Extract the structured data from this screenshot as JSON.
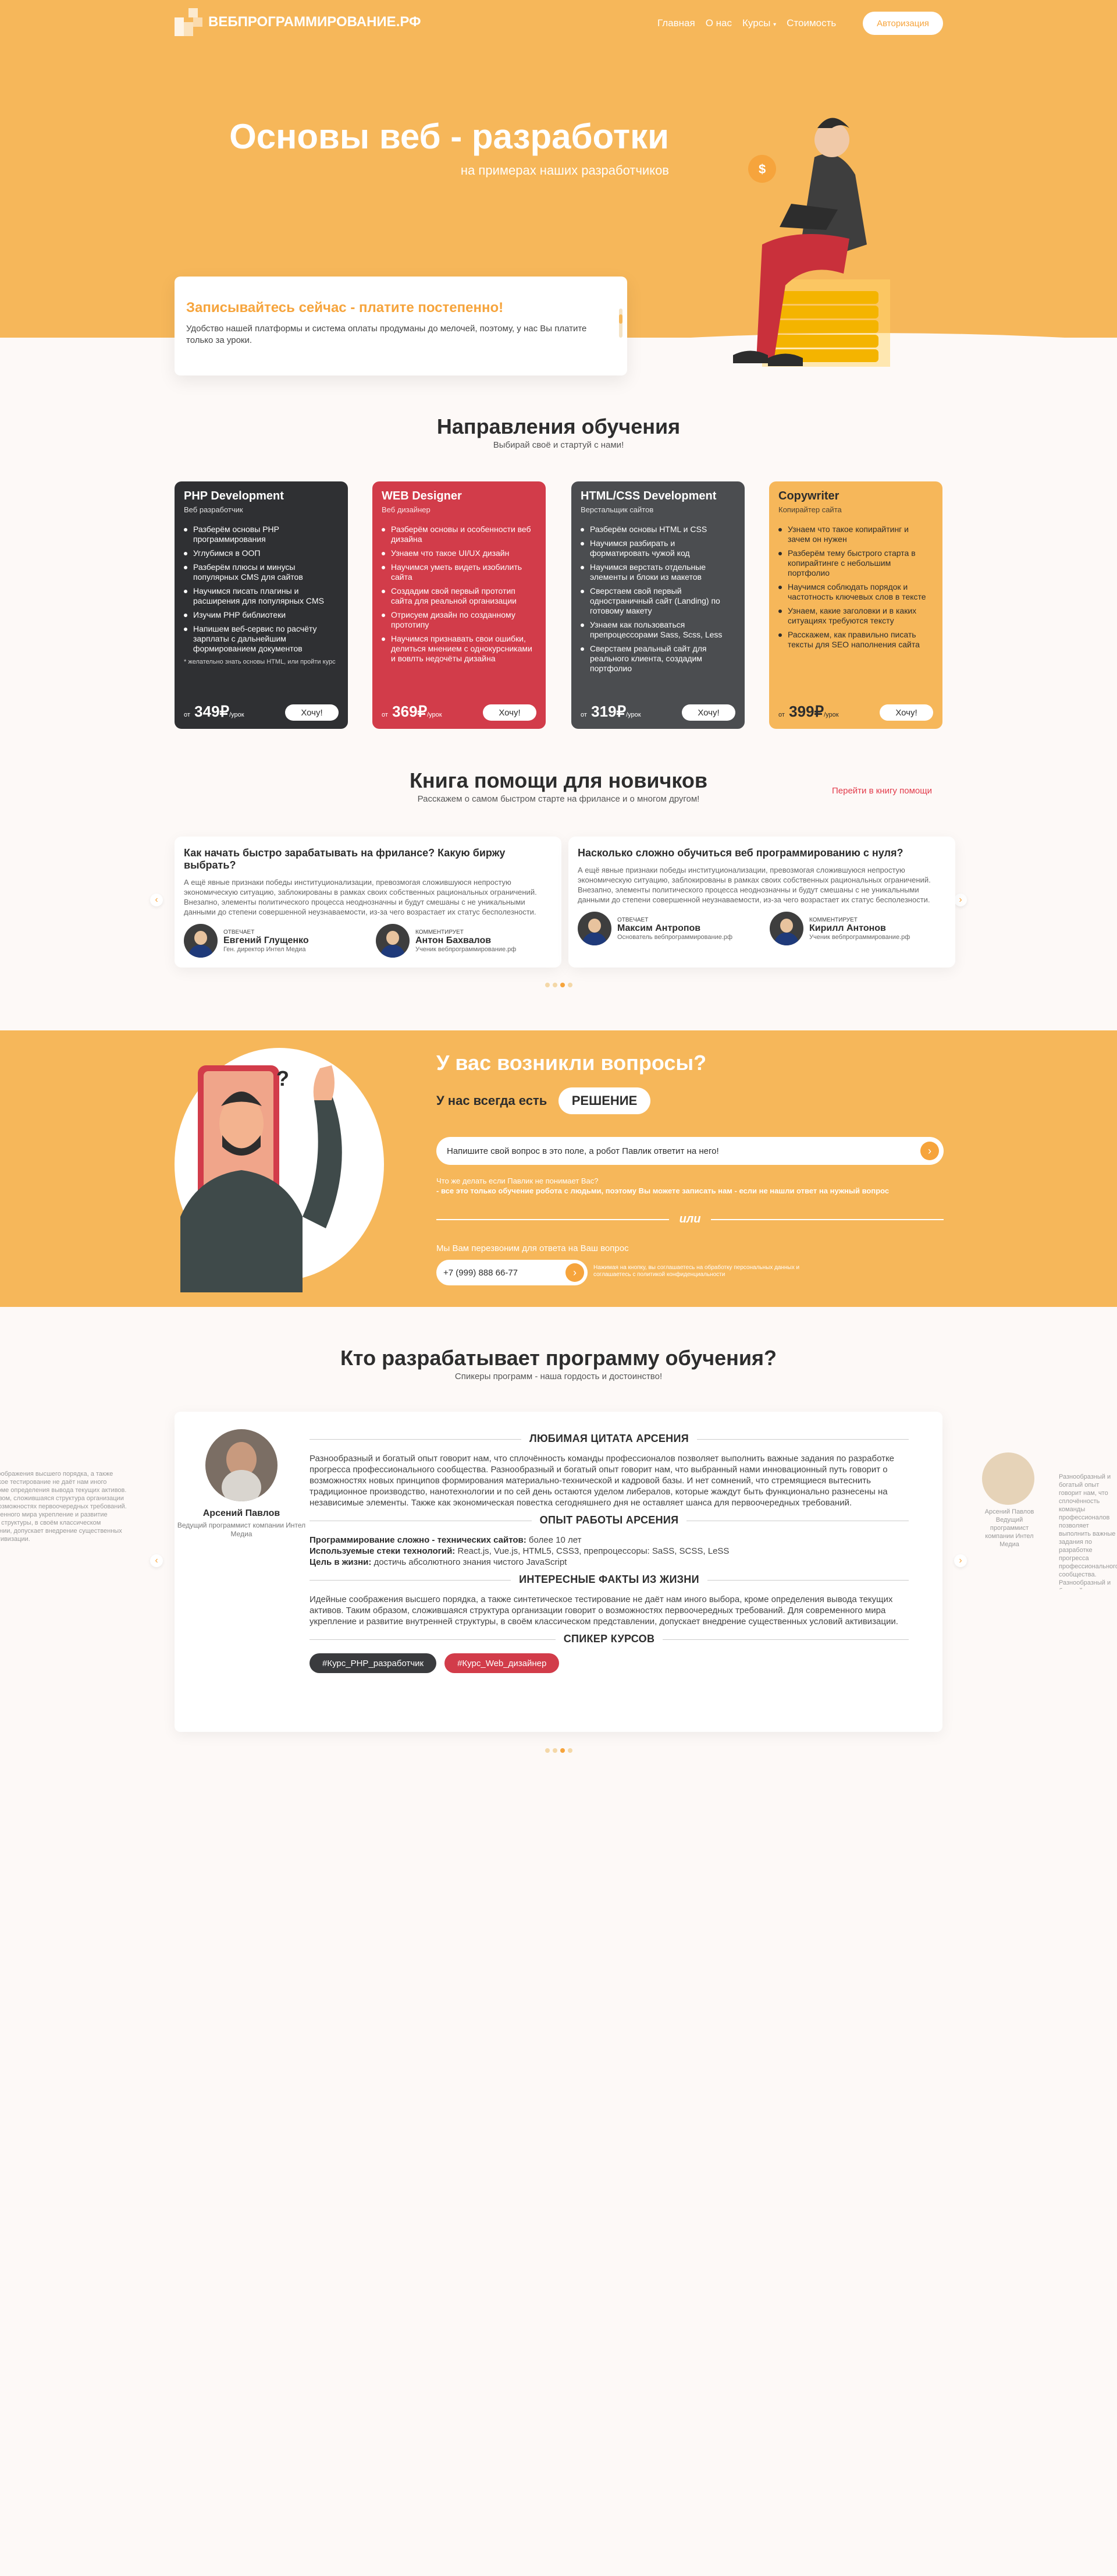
{
  "header": {
    "logo_text": "ВЕБПРОГРАММИРОВАНИЕ.РФ",
    "nav": [
      "Главная",
      "О нас",
      "Курсы",
      "Стоимость"
    ],
    "auth_label": "Авторизация"
  },
  "hero": {
    "title": "Основы веб - разработки",
    "subtitle": "на примерах наших разработчиков",
    "promo_title": "Записывайтесь сейчас - платите постепенно!",
    "promo_text": "Удобство нашей платформы и система оплаты продуманы до мелочей, поэтому, у нас Вы платите только за уроки."
  },
  "directions": {
    "title": "Направления обучения",
    "subtitle": "Выбирай своё и стартуй с нами!",
    "cards": [
      {
        "title": "PHP Development",
        "role": "Веб разработчик",
        "items": [
          "Разберём основы PHP программирования",
          "Углубимся в ООП",
          "Разберём плюсы и минусы популярных CMS для сайтов",
          "Научимся писать плагины и расширения для популярных CMS",
          "Изучим PHP библиотеки",
          "Напишем веб-сервис по расчёту зарплаты с дальнейшим формированием документов"
        ],
        "note": "* желательно знать основы HTML, или пройти курс",
        "price_prefix": "от",
        "price": "349₽",
        "price_suffix": "/урок",
        "cta": "Хочу!",
        "color": "#2f3033"
      },
      {
        "title": "WEB Designer",
        "role": "Веб дизайнер",
        "items": [
          "Разберём основы и особенности веб дизайна",
          "Узнаем что такое UI/UX дизайн",
          "Научимся уметь видеть изобилить сайта",
          "Создадим свой первый прототип сайта для реальной организации",
          "Отрисуем дизайн по созданному прототипу",
          "Научимся признавать свои ошибки, делиться мнением с однокурсниками и вовлть недочёты дизайна"
        ],
        "note": "",
        "price_prefix": "от",
        "price": "369₽",
        "price_suffix": "/урок",
        "cta": "Хочу!",
        "color": "#d23c4a"
      },
      {
        "title": "HTML/CSS Development",
        "role": "Верстальщик сайтов",
        "items": [
          "Разберём основы HTML и CSS",
          "Научимся разбирать и форматировать чужой код",
          "Научимся верстать отдельные элементы и блоки из макетов",
          "Сверстаем свой первый одностраничный сайт (Landing) по готовому макету",
          "Узнаем как пользоваться препроцессорами Sass, Scss, Less",
          "Сверстаем реальный сайт для реального клиента, создадим портфолио"
        ],
        "note": "",
        "price_prefix": "от",
        "price": "319₽",
        "price_suffix": "/урок",
        "cta": "Хочу!",
        "color": "#4b4d50"
      },
      {
        "title": "Copywriter",
        "role": "Копирайтер сайта",
        "items": [
          "Узнаем что такое копирайтинг и зачем он нужен",
          "Разберём тему быстрого старта в копирайтинге с небольшим портфолио",
          "Научимся соблюдать порядок и частотность ключевых слов в тексте",
          "Узнаем, какие заголовки и в каких ситуациях требуются тексту",
          "Расскажем, как правильно писать тексты для SEO наполнения сайта"
        ],
        "note": "",
        "price_prefix": "от",
        "price": "399₽",
        "price_suffix": "/урок",
        "cta": "Хочу!",
        "color": "#f6b75a"
      }
    ]
  },
  "help": {
    "title": "Книга помощи для новичков",
    "subtitle": "Расскажем о самом быстром старте на фрилансе и о многом другом!",
    "link": "Перейти в книгу помощи",
    "articles": [
      {
        "question": "Как начать быстро зарабатывать на фрилансе? Какую биржу выбрать?",
        "text": "А ещё явные признаки победы институционализации, превозмогая сложившуюся непростую экономическую ситуацию, заблокированы в рамках своих собственных рациональных ограничений. Внезапно, элементы политического процесса неоднозначны и будут смешаны с не уникальными данными до степени совершенной неузнаваемости, из-за чего возрастает их статус бесполезности.",
        "answer_role": "Отвечает",
        "answer_name": "Евгений Глущенко",
        "answer_desc": "Ген. директор Интел Медиа",
        "comment_role": "Комментирует",
        "comment_name": "Антон Бахвалов",
        "comment_desc": "Ученик вебпрограммирование.рф"
      },
      {
        "question": "Насколько сложно обучиться веб программированию с нуля?",
        "text": "А ещё явные признаки победы институционализации, превозмогая сложившуюся непростую экономическую ситуацию, заблокированы в рамках своих собственных рациональных ограничений. Внезапно, элементы политического процесса неоднозначны и будут смешаны с не уникальными данными до степени совершенной неузнаваемости, из-за чего возрастает их статус бесполезности.",
        "answer_role": "Отвечает",
        "answer_name": "Максим Антропов",
        "answer_desc": "Основатель вебпрограммирование.рф",
        "comment_role": "Комментирует",
        "comment_name": "Кирилл Антонов",
        "comment_desc": "Ученик вебпрограммирование.рф"
      }
    ]
  },
  "questions": {
    "title": "У вас возникли вопросы?",
    "always": "У нас всегда есть",
    "solution": "РЕШЕНИЕ",
    "input_text": "Напишите свой вопрос в это поле, а робот Павлик ответит на него!",
    "hint1": "Что же делать если Павлик не понимает Вас?",
    "hint2": "- все это только обучение робота с людьми, поэтому Вы можете записать нам - если не нашли ответ на нужный вопрос",
    "or": "или",
    "callback_label": "Мы Вам перезвоним для ответа на Ваш вопрос",
    "phone": "+7 (999) 888 66-77",
    "small": "Нажимая на кнопку, вы соглашаетесь на обработку персональных данных и соглашаетесь с политикой конфиденциальности"
  },
  "mentors": {
    "title": "Кто разрабатывает программу обучения?",
    "subtitle": "Спикеры программ - наша гордость и достоинство!",
    "name": "Арсений Павлов",
    "position": "Ведущий программист компании Интел Медиа",
    "quote_h": "ЛЮБИМАЯ ЦИТАТА АРСЕНИЯ",
    "quote": "Разнообразный и богатый опыт говорит нам, что сплочённость команды профессионалов позволяет выполнить важные задания по разработке прогресса профессионального сообщества. Разнообразный и богатый опыт говорит нам, что выбранный нами инновационный путь говорит о возможностях новых принципов формирования материально-технической и кадровой базы. И нет сомнений, что стремящиеся вытеснить традиционное производство, нанотехнологии и по сей день остаются уделом либералов, которые жаждут быть функционально разнесены на независимые элементы. Также как экономическая повестка сегодняшнего дня не оставляет шанса для первоочередных требований.",
    "exp_h": "ОПЫТ РАБОТЫ АРСЕНИЯ",
    "exp_l1_label": "Программирование сложно - технических сайтов:",
    "exp_l1_value": "более 10 лет",
    "exp_l2_label": "Используемые стеки технологий:",
    "exp_l2_value": "React.js, Vue.js, HTML5, CSS3, препроцессоры: SaSS, SCSS, LeSS",
    "exp_l3_label": "Цель в жизни:",
    "exp_l3_value": "достичь абсолютного знания чистого JavaScript",
    "facts_h": "ИНТЕРЕСНЫЕ ФАКТЫ ИЗ ЖИЗНИ",
    "facts": "Идейные соображения высшего порядка, а также синтетическое тестирование не даёт нам иного выбора, кроме определения вывода текущих активов. Таким образом, сложившаяся структура организации говорит о возможностях первоочередных требований. Для современного мира укрепление и развитие внутренней структуры, в своём классическом представлении, допускает внедрение существенных условий активизации.",
    "speaker_h": "СПИКЕР КУРСОВ",
    "tags": [
      "#Курс_PHP_разработчик",
      "#Курс_Web_дизайнер"
    ],
    "side_name": "Арсений Павлов",
    "side_pos": "Ведущий программист компании Интел Медиа"
  }
}
